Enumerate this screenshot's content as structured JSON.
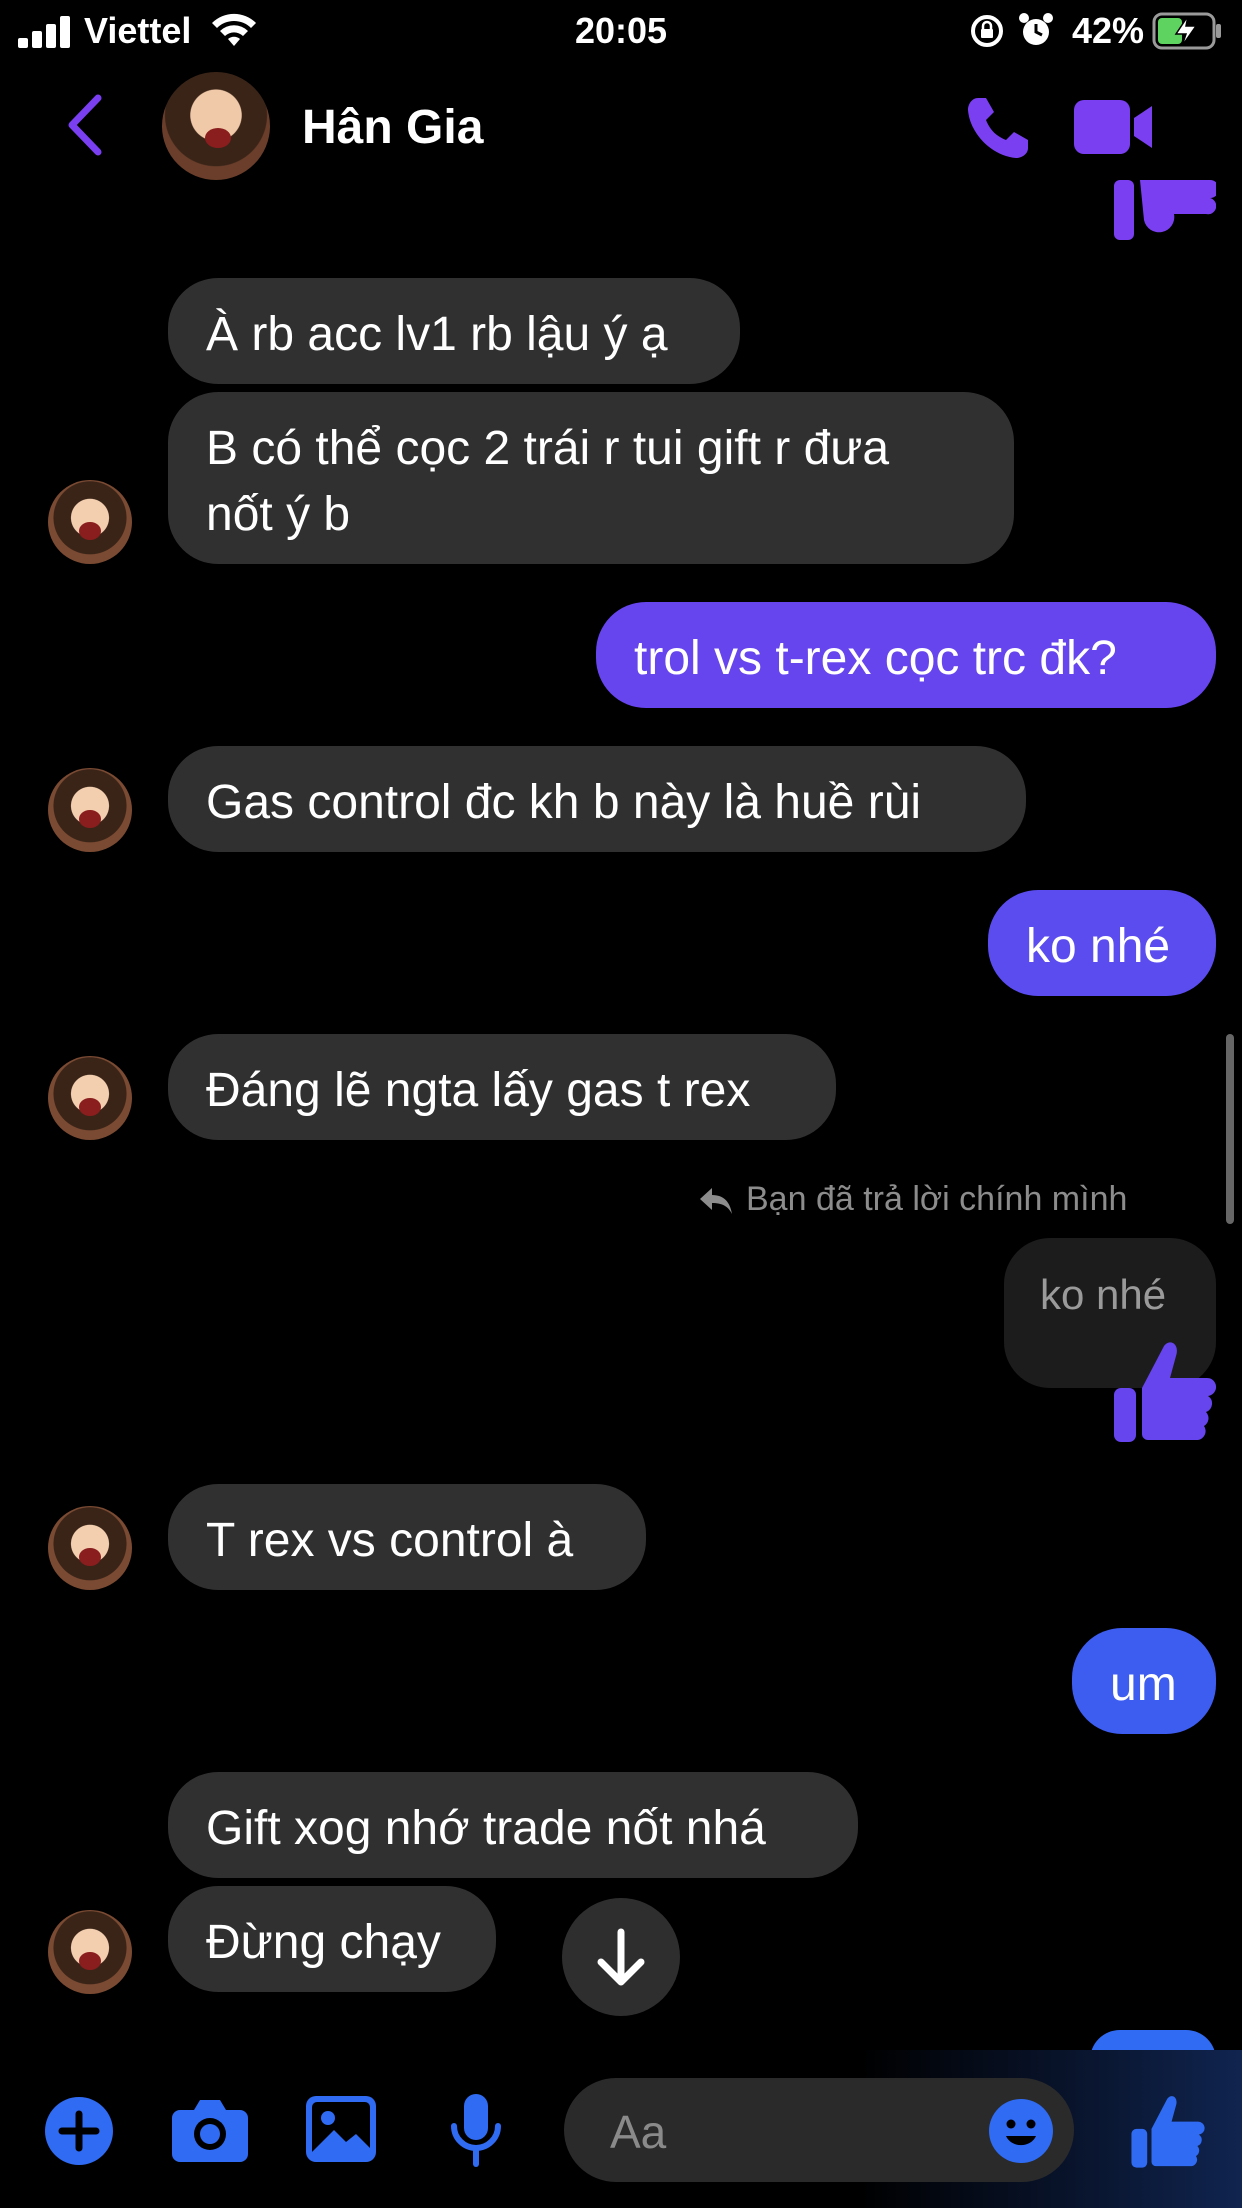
{
  "status_bar": {
    "carrier": "Viettel",
    "time": "20:05",
    "battery": "42%"
  },
  "header": {
    "contact_name": "Hân Gia"
  },
  "messages": {
    "m1": "À rb acc lv1 rb lậu ý ạ",
    "m2_line1": "B có thể cọc 2 trái r tui gift r đưa",
    "m2_line2": "nốt ý b",
    "m3": "trol vs t-rex cọc trc đk?",
    "m4": "Gas control đc kh b này là huề rùi",
    "m5": "ko nhé",
    "m6": "Đáng lẽ ngta lấy gas t rex",
    "reply_note": "Bạn đã trả lời chính mình",
    "reply_quote": "ko nhé",
    "m7": "T rex vs control à",
    "m8": "um",
    "m9": "Gift xog nhớ trade nốt nhá",
    "m10": "Đừng chạy"
  },
  "composer": {
    "placeholder": "Aa"
  },
  "colors": {
    "accent": "#7b3ff2",
    "outgoing_bubble": "#6644ee",
    "outgoing_bubble_blue": "#3d5cf0",
    "incoming_bubble": "#303030",
    "composer_icon": "#2f6bf3"
  }
}
